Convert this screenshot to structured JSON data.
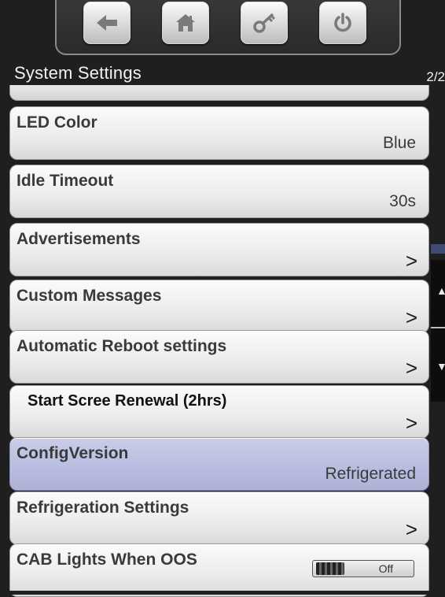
{
  "nav": {
    "buttons": [
      {
        "id": "back",
        "icon": "back-arrow-icon"
      },
      {
        "id": "home",
        "icon": "home-icon"
      },
      {
        "id": "key",
        "icon": "key-icon"
      },
      {
        "id": "power",
        "icon": "power-icon"
      }
    ]
  },
  "header": {
    "title": "System Settings",
    "page": "2/2"
  },
  "settings": [
    {
      "label": "LED Color",
      "value": "Blue"
    },
    {
      "label": "Idle Timeout",
      "value": "30s"
    },
    {
      "label": "Advertisements",
      "value": ">"
    },
    {
      "label": "Custom Messages",
      "value": ">"
    },
    {
      "label": "Automatic Reboot settings",
      "value": ">"
    },
    {
      "label": "Start Scree Renewal (2hrs)",
      "value": ">"
    },
    {
      "label": "ConfigVersion",
      "value": "Refrigerated"
    },
    {
      "label": "Refrigeration Settings",
      "value": ">"
    },
    {
      "label": "CAB Lights When OOS",
      "toggle": "Off"
    }
  ],
  "colors": {
    "background": "#1f1f1f",
    "row": "#ebebeb",
    "highlight_row": "#b8bde0",
    "text": "#3a3a3a"
  }
}
